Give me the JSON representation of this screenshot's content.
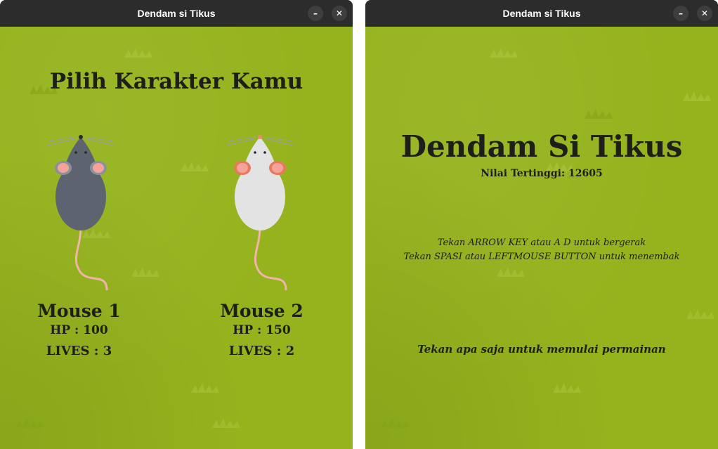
{
  "window_left": {
    "title": "Dendam si Tikus",
    "minimize_glyph": "–",
    "close_glyph": "✕",
    "heading": "Pilih Karakter Kamu",
    "characters": [
      {
        "name": "Mouse 1",
        "hp": "HP : 100",
        "lives": "LIVES : 3",
        "body_color": "#5d6470"
      },
      {
        "name": "Mouse 2",
        "hp": "HP : 150",
        "lives": "LIVES : 2",
        "body_color": "#e3e3e3"
      }
    ]
  },
  "window_right": {
    "title": "Dendam si Tikus",
    "minimize_glyph": "–",
    "close_glyph": "✕",
    "game_title": "Dendam Si Tikus",
    "high_score": "Nilai Tertinggi: 12605",
    "instructions": [
      "Tekan ARROW KEY atau A D untuk bergerak",
      "Tekan SPASI atau LEFTMOUSE BUTTON untuk menembak"
    ],
    "start_prompt": "Tekan apa saja untuk memulai permainan"
  },
  "colors": {
    "grass": "#95b31d",
    "titlebar": "#2c2c2c",
    "text": "#1f1f1a",
    "ear_inner": "#f4a29a",
    "tail": "#f2b4a8"
  }
}
